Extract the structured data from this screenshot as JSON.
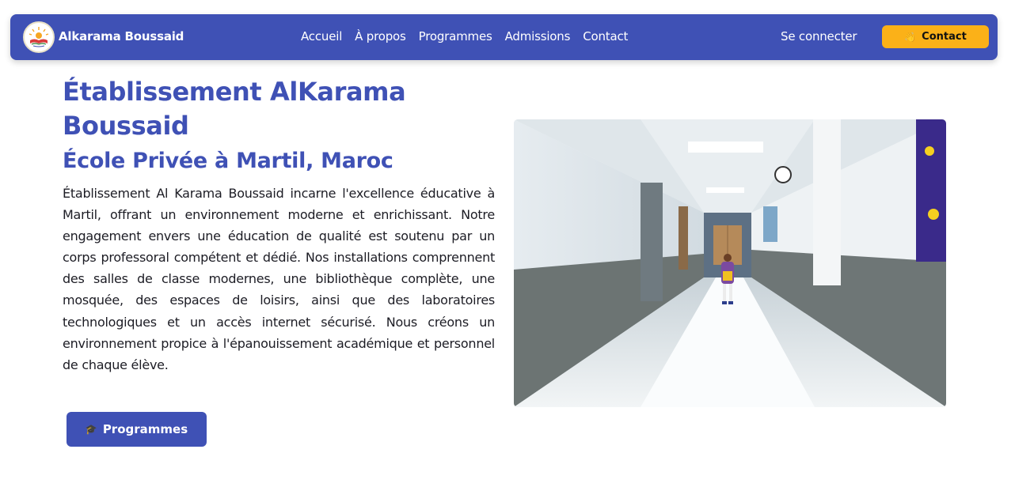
{
  "header": {
    "brand": "Alkarama Boussaid",
    "logo_icon": "school-logo-icon",
    "nav": [
      "Accueil",
      "À propos",
      "Programmes",
      "Admissions",
      "Contact"
    ],
    "login_label": "Se connecter",
    "contact_label": "Contact",
    "contact_icon": "hand-wave-icon"
  },
  "hero": {
    "title": "Établissement AlKarama Boussaid",
    "subtitle": "École Privée à Martil, Maroc",
    "description": "Établissement Al Karama Boussaid incarne l'excellence éducative à Martil, offrant un environnement moderne et enrichissant. Notre engagement envers une éducation de qualité est soutenu par un corps professoral compétent et dédié. Nos installations comprennent des salles de classe modernes, une bibliothèque complète, une mosquée, des espaces de loisirs, ainsi que des laboratoires technologiques et un accès internet sécurisé. Nous créons un environnement propice à l'épanouissement académique et personnel de chaque élève.",
    "button_label": "Programmes",
    "button_icon": "graduation-cap-icon",
    "image_subject": "school-hallway-photo"
  },
  "colors": {
    "primary": "#3f51b5",
    "accent": "#fbb118",
    "text": "#1c1c24",
    "background": "#ffffff"
  }
}
